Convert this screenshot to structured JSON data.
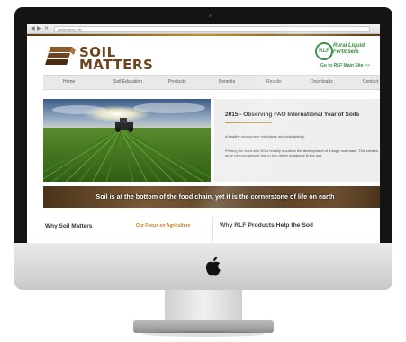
{
  "browser": {
    "back": "◀",
    "forward": "▶",
    "close": "✕",
    "url": "soilmatters.info"
  },
  "header": {
    "logo_line1": "SOIL",
    "logo_line2": "MATTERS",
    "partner_badge": "RLF",
    "partner_name_line1": "Rural Liquid",
    "partner_name_line2": "Fertilisers",
    "partner_link": "Go to RLF Main Site",
    "partner_link_arrow": ">>"
  },
  "nav": {
    "items": [
      "Home",
      "Soil Education",
      "Products",
      "Benefits",
      "Results",
      "Downloads",
      "Contact"
    ]
  },
  "hero": {
    "title": "2015 - Observing FAO International Year of Soils",
    "para1": "A healthy rhizosphere stimulates microbial activity.",
    "para2": "Priming the seed with BSM reliably results in the development of a large root mass. This creates more microorganisms that in turn return goodness to the soil."
  },
  "banner": {
    "text": "Soil is at the bottom of the food chain, yet it is the cornerstone of life on earth"
  },
  "lower": {
    "col1_heading": "Why Soil Matters",
    "col2_heading": "Our Focus on Agriculture",
    "col3_heading": "Why RLF Products Help the Soil"
  },
  "colors": {
    "brand_brown": "#6b4420",
    "partner_green": "#2d8a3b",
    "accent_gold": "#c9a04a",
    "link_orange": "#c97a1e"
  }
}
